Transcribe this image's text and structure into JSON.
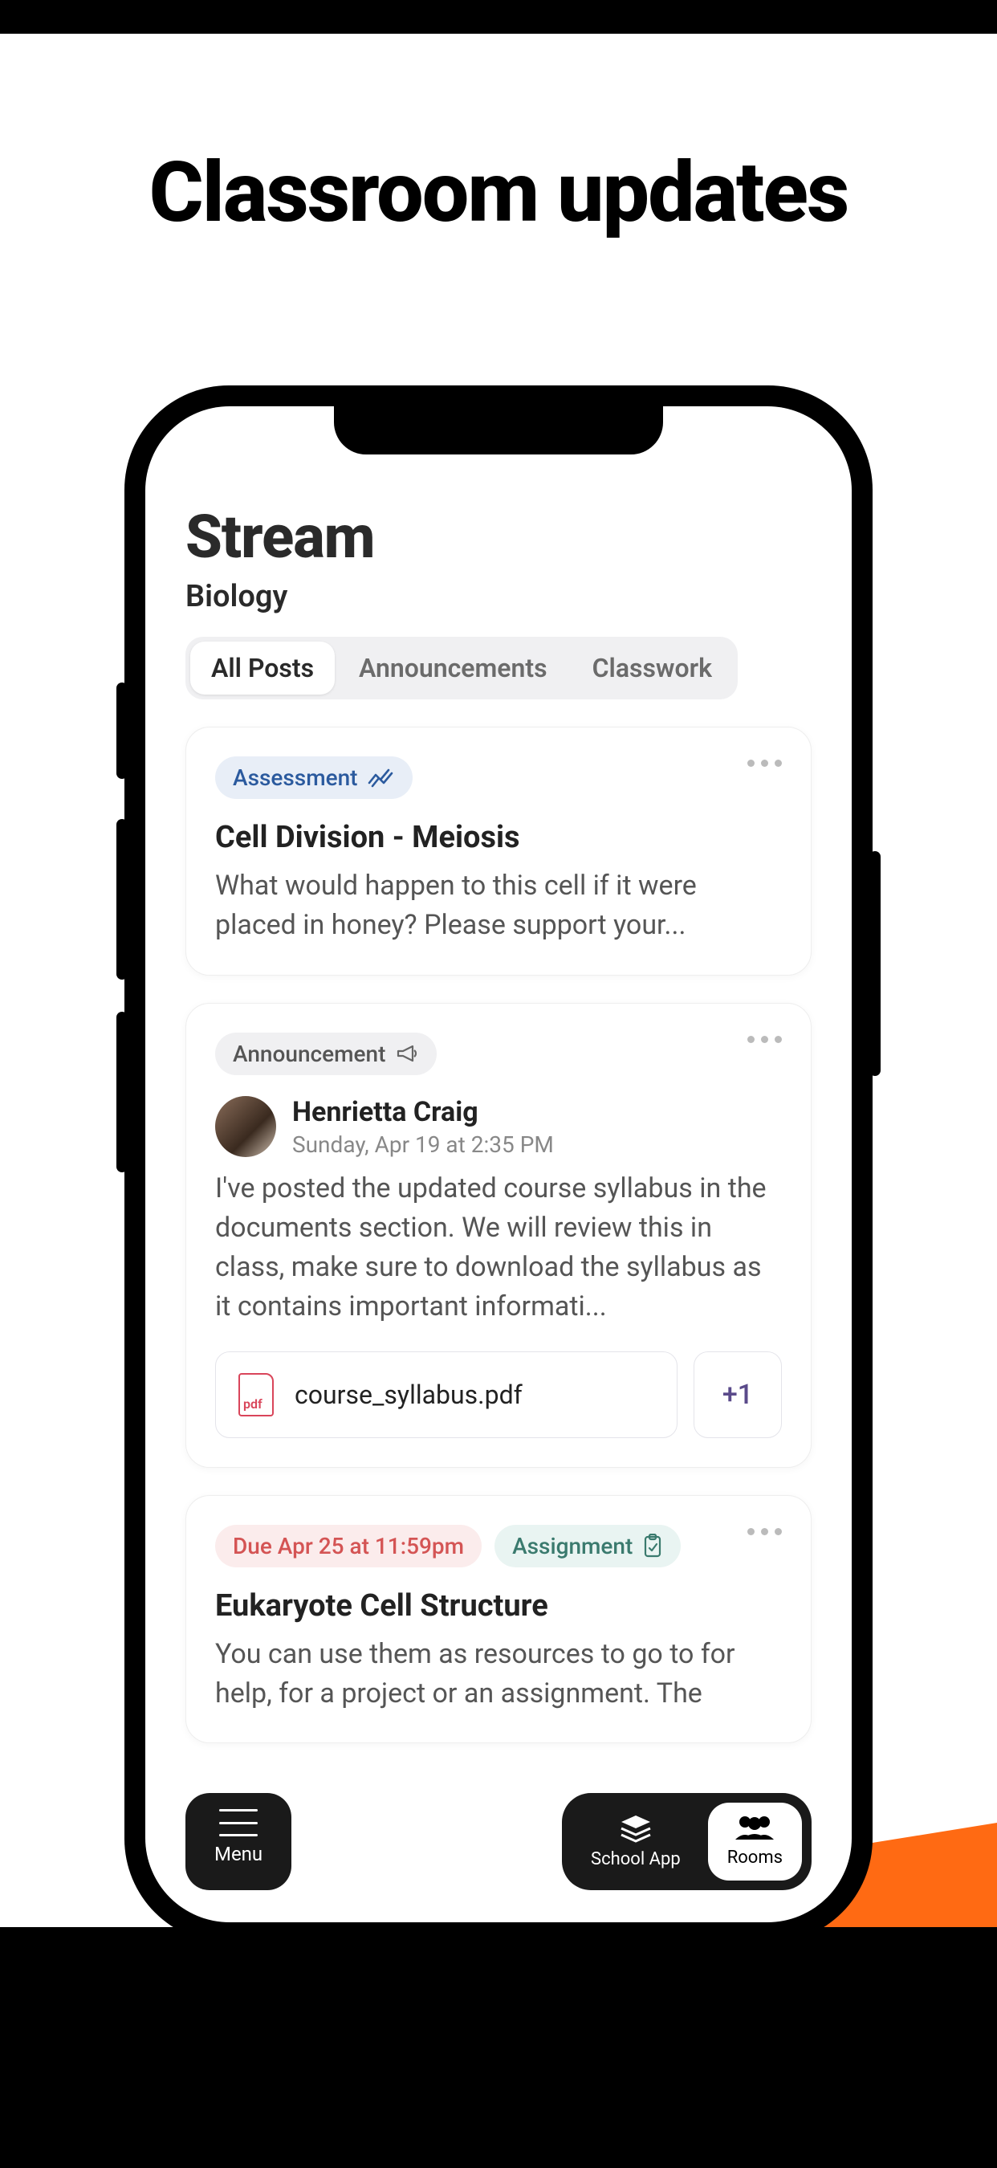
{
  "marketing": {
    "title": "Classroom updates"
  },
  "header": {
    "title": "Stream",
    "subtitle": "Biology"
  },
  "tabs": [
    {
      "label": "All Posts",
      "active": true
    },
    {
      "label": "Announcements",
      "active": false
    },
    {
      "label": "Classwork",
      "active": false
    }
  ],
  "posts": [
    {
      "badge_type": "assessment",
      "badge_label": "Assessment",
      "title": "Cell Division - Meiosis",
      "body": "What would happen to this cell if it were placed in honey? Please support your..."
    },
    {
      "badge_type": "announcement",
      "badge_label": "Announcement",
      "author": {
        "name": "Henrietta Craig",
        "date": "Sunday, Apr 19 at 2:35 PM"
      },
      "body": "I've posted the updated course syllabus in the documents section. We will review this in class, make sure to download the syllabus as it contains important informati...",
      "attachment": {
        "name": "course_syllabus.pdf",
        "more": "+1"
      }
    },
    {
      "due_label": "Due Apr 25 at 11:59pm",
      "badge_type": "assignment",
      "badge_label": "Assignment",
      "title": "Eukaryote Cell Structure",
      "body": "You can use them as resources to go to for help, for a project or an assignment. The"
    }
  ],
  "bottom": {
    "menu": "Menu",
    "school_app": "School App",
    "rooms": "Rooms"
  }
}
